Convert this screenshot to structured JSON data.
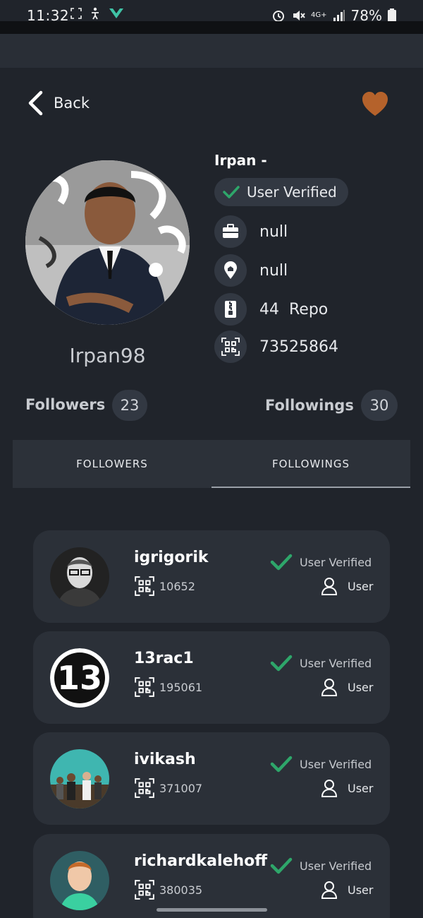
{
  "status_bar": {
    "time": "11:32",
    "battery": "78%",
    "network": "4G+"
  },
  "header": {
    "back_label": "Back",
    "favorite_icon": "heart-icon",
    "favorite_color": "#b5622b"
  },
  "profile": {
    "name": "Irpan -",
    "verified_label": "User Verified",
    "username": "Irpan98",
    "company": "null",
    "location": "null",
    "repos_count": "44",
    "repos_label": "Repo",
    "user_id": "73525864"
  },
  "counts": {
    "followers_label": "Followers",
    "followers_value": "23",
    "followings_label": "Followings",
    "followings_value": "30"
  },
  "tabs": [
    {
      "label": "FOLLOWERS",
      "selected": false
    },
    {
      "label": "FOLLOWINGS",
      "selected": true
    }
  ],
  "users": [
    {
      "login": "igrigorik",
      "id": "10652",
      "verified_label": "User Verified",
      "type": "User"
    },
    {
      "login": "13rac1",
      "id": "195061",
      "verified_label": "User Verified",
      "type": "User"
    },
    {
      "login": "ivikash",
      "id": "371007",
      "verified_label": "User Verified",
      "type": "User"
    },
    {
      "login": "richardkalehoff",
      "id": "380035",
      "verified_label": "User Verified",
      "type": "User"
    }
  ],
  "colors": {
    "background": "#20242b",
    "card": "#2b3038",
    "accent_check": "#2ea66a"
  }
}
